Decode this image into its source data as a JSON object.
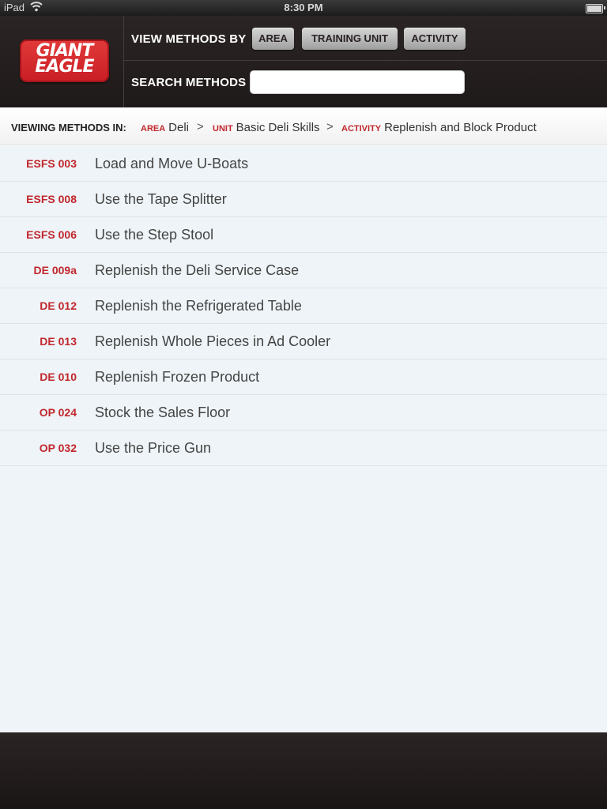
{
  "status_bar": {
    "device": "iPad",
    "time": "8:30 PM",
    "wifi_icon": "wifi-icon",
    "battery_icon": "battery-icon"
  },
  "header": {
    "logo_line1": "GIANT",
    "logo_line2": "EAGLE",
    "view_methods_label": "VIEW METHODS BY",
    "filter_buttons": [
      {
        "label": "AREA"
      },
      {
        "label": "TRAINING UNIT"
      },
      {
        "label": "ACTIVITY"
      }
    ],
    "search_label": "SEARCH METHODS",
    "search_value": ""
  },
  "breadcrumb": {
    "lead": "VIEWING METHODS IN:",
    "area_key": "AREA",
    "area_value": "Deli",
    "unit_key": "UNIT",
    "unit_value": "Basic Deli Skills",
    "activity_key": "ACTIVITY",
    "activity_value": "Replenish and Block Product",
    "separator": ">"
  },
  "methods": [
    {
      "code": "ESFS 003",
      "title": "Load and Move U-Boats"
    },
    {
      "code": "ESFS 008",
      "title": "Use the Tape Splitter"
    },
    {
      "code": "ESFS 006",
      "title": "Use the Step Stool"
    },
    {
      "code": "DE 009a",
      "title": "Replenish the Deli Service Case"
    },
    {
      "code": "DE 012",
      "title": "Replenish the Refrigerated Table"
    },
    {
      "code": "DE 013",
      "title": "Replenish Whole Pieces in Ad Cooler"
    },
    {
      "code": "DE 010",
      "title": "Replenish Frozen Product"
    },
    {
      "code": "OP 024",
      "title": "Stock the Sales Floor"
    },
    {
      "code": "OP 032",
      "title": "Use the Price Gun"
    }
  ],
  "colors": {
    "brand_red": "#c1272d",
    "header_dark": "#241e1e",
    "list_background": "#eef4f7"
  }
}
